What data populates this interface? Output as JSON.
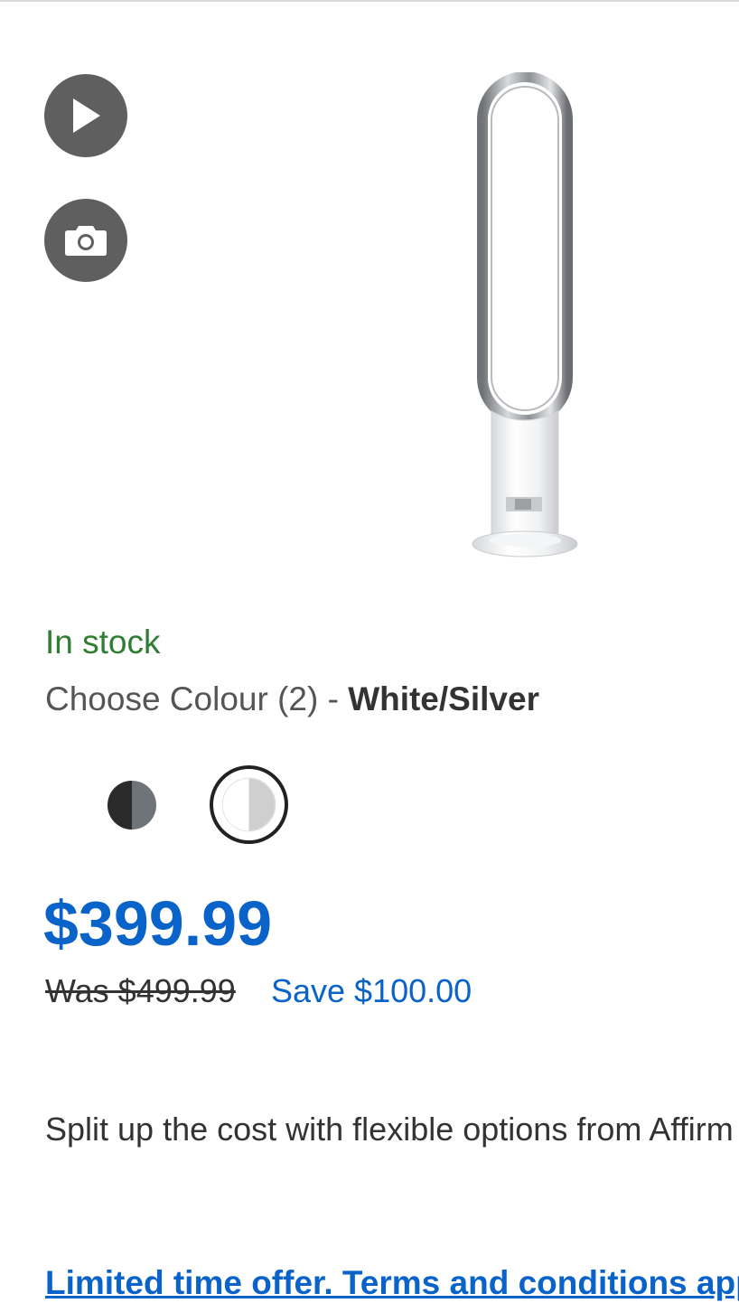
{
  "media": {
    "video_icon": "play-icon",
    "photo_icon": "camera-icon"
  },
  "product": {
    "image_icon": "tower-fan-icon",
    "stock_status": "In stock",
    "colour_prefix": "Choose Colour (2) - ",
    "selected_colour": "White/Silver",
    "swatches": [
      {
        "name": "Black/Nickel",
        "colors": [
          "#2b2b2b",
          "#6e7479"
        ]
      },
      {
        "name": "White/Silver",
        "colors": [
          "#ffffff",
          "#cfcfcf"
        ],
        "selected": true
      }
    ]
  },
  "pricing": {
    "price": "$399.99",
    "was": "Was $499.99",
    "save": "Save $100.00"
  },
  "financing": {
    "text": "Split up the cost with flexible options from Affirm"
  },
  "offer": {
    "text": "Limited time offer. Terms and conditions apply"
  },
  "colors": {
    "accent_blue": "#0a63c9",
    "stock_green": "#2e7d32",
    "media_button": "#5f5f5f"
  }
}
